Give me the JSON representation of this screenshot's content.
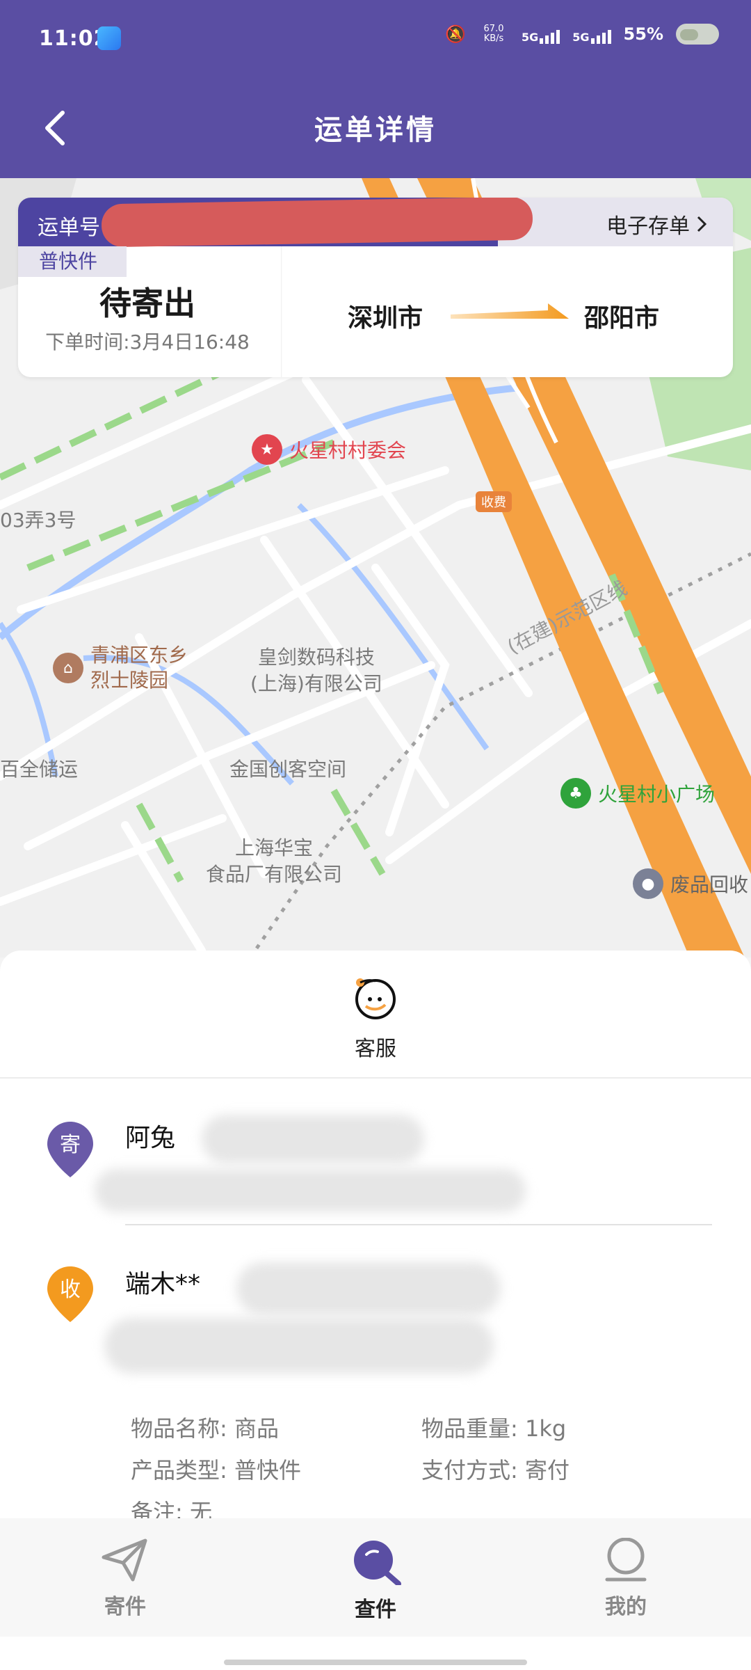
{
  "status_bar": {
    "time": "11:02",
    "net_speed": "67.0 KB/s",
    "sig1": "5G",
    "sig2": "5G",
    "battery": "55%"
  },
  "header": {
    "title": "运单详情"
  },
  "order": {
    "number_label": "运单号",
    "estore_label": "电子存单",
    "type_badge": "普快件",
    "status": "待寄出",
    "order_time": "下单时间:3月4日16:48",
    "from_city": "深圳市",
    "to_city": "邵阳市"
  },
  "map": {
    "labels": {
      "poi1": "火星村村委会",
      "toll": "收费",
      "addr_left": "03弄3号",
      "poi2_line1": "青浦区东乡",
      "poi2_line2": "烈士陵园",
      "company1_line1": "皇剑数码科技",
      "company1_line2": "(上海)有限公司",
      "rail": "(在建)示范区线",
      "storage": "百全储运",
      "maker_space": "金国创客空间",
      "poi3": "火星村小广场",
      "food1": "上海华宝",
      "food2": "食品厂有限公司",
      "recycle": "废品回收"
    }
  },
  "customer_service": {
    "label": "客服"
  },
  "sender": {
    "badge": "寄",
    "name": "阿兔"
  },
  "receiver": {
    "badge": "收",
    "name": "端木**"
  },
  "details": {
    "item_name_label": "物品名称:",
    "item_name": "商品",
    "weight_label": "物品重量:",
    "weight": "1kg",
    "product_type_label": "产品类型:",
    "product_type": "普快件",
    "payment_label": "支付方式:",
    "payment": "寄付",
    "remark_label": "备注:",
    "remark": "无"
  },
  "tabs": [
    {
      "label": "寄件",
      "icon": "send-icon"
    },
    {
      "label": "查件",
      "icon": "search-icon"
    },
    {
      "label": "我的",
      "icon": "profile-icon"
    }
  ],
  "colors": {
    "brand": "#5a4ea3",
    "route": "#f5a142",
    "receiver_pin": "#f39a1f",
    "sender_pin": "#6a5aa8"
  }
}
